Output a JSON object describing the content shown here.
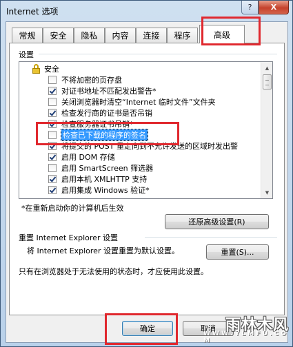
{
  "window": {
    "title": "Internet 选项",
    "help_label": "?",
    "close_label": "X"
  },
  "tabs": [
    {
      "label": "常规"
    },
    {
      "label": "安全"
    },
    {
      "label": "隐私"
    },
    {
      "label": "内容"
    },
    {
      "label": "连接"
    },
    {
      "label": "程序"
    },
    {
      "label": "高级"
    }
  ],
  "active_tab": "高级",
  "settings": {
    "group_label": "设置",
    "category_label": "安全",
    "items": [
      {
        "label": "不将加密的页存盘",
        "checked": false
      },
      {
        "label": "对证书地址不匹配发出警告*",
        "checked": true
      },
      {
        "label": "关闭浏览器时清空“Internet 临时文件”文件夹",
        "checked": false
      },
      {
        "label": "检查发行商的证书是否吊销",
        "checked": true
      },
      {
        "label": "检查服务器证书吊销*",
        "checked": true
      },
      {
        "label": "检查已下载的程序的签名",
        "checked": false,
        "selected": true
      },
      {
        "label": "将提交的 POST 重定向到不允许发送的区域时发出警",
        "checked": true
      },
      {
        "label": "启用 DOM 存储",
        "checked": true
      },
      {
        "label": "启用 SmartScreen 筛选器",
        "checked": false
      },
      {
        "label": "启用本机 XMLHTTP 支持",
        "checked": true
      },
      {
        "label": "启用集成 Windows 验证*",
        "checked": true
      }
    ],
    "restart_note": "*在重新启动你的计算机后生效",
    "restore_button": "还原高级设置(R)"
  },
  "reset": {
    "group_label": "重置 Internet Explorer 设置",
    "description": "将 Internet Explorer 设置重置为默认设置。",
    "reset_button": "重置(S)...",
    "note": "只有在浏览器处于无法使用的状态时，才应使用此设置。"
  },
  "footer": {
    "ok_button": "确定",
    "cancel_button": "取消"
  },
  "watermark": {
    "text": "雨林木风",
    "url": "W W W . Y L M F U . C O M"
  },
  "colors": {
    "highlight": "#e0282e",
    "selection": "#3399ff"
  }
}
